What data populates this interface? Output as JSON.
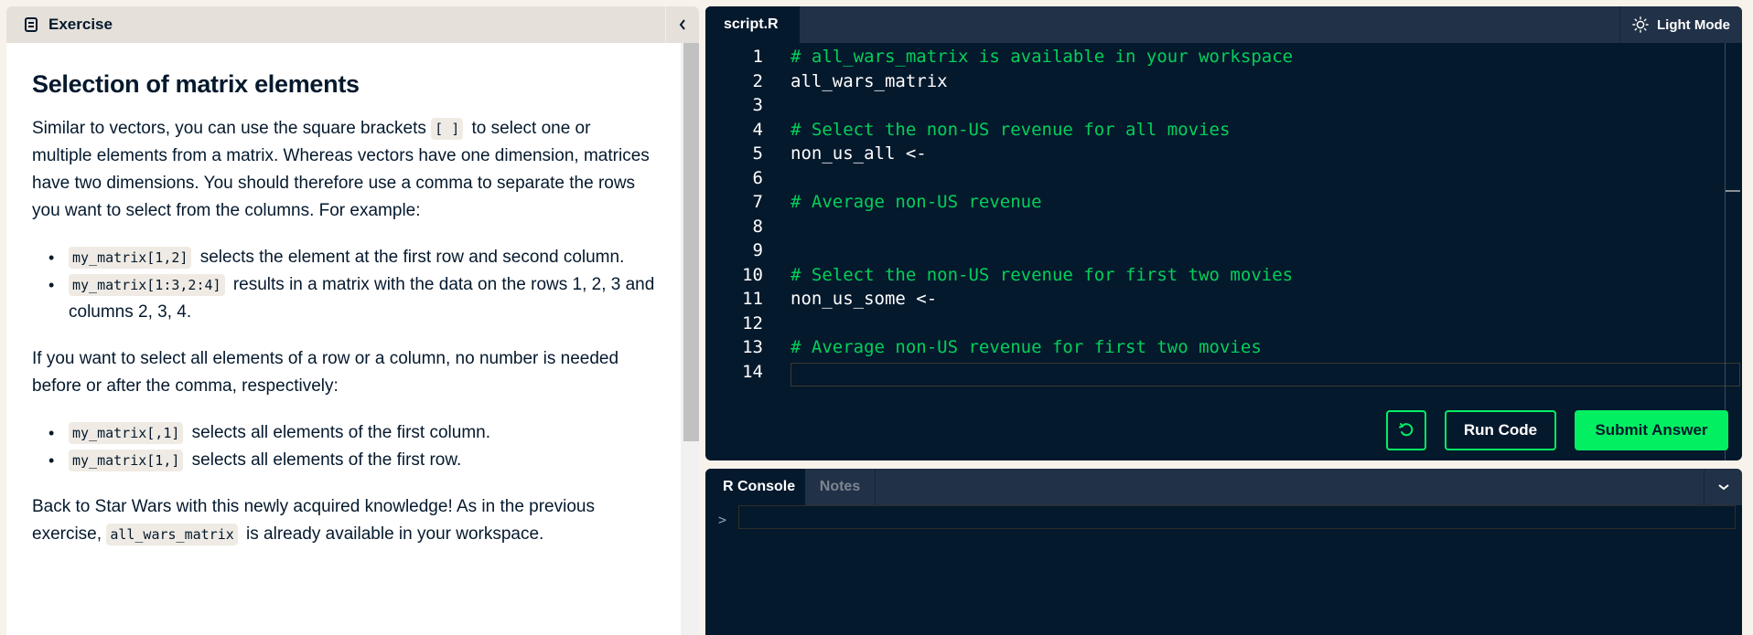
{
  "exercise_panel": {
    "header_title": "Exercise",
    "header_icon": "document-icon",
    "collapse_icon": "chevron-left-icon",
    "title": "Selection of matrix elements",
    "intro": {
      "before_code": "Similar to vectors, you can use the square brackets ",
      "code": "[ ]",
      "after_code": " to select one or multiple elements from a matrix. Whereas vectors have one dimension, matrices have two dimensions. You should therefore use a comma to separate the rows you want to select from the columns. For example:"
    },
    "examples_1": [
      {
        "code": "my_matrix[1,2]",
        "text": " selects the element at the first row and second column."
      },
      {
        "code": "my_matrix[1:3,2:4]",
        "text": " results in a matrix with the data on the rows 1, 2, 3 and columns 2, 3, 4."
      }
    ],
    "paragraph_2": "If you want to select all elements of a row or a column, no number is needed before or after the comma, respectively:",
    "examples_2": [
      {
        "code": "my_matrix[,1]",
        "text": " selects all elements of the first column."
      },
      {
        "code": "my_matrix[1,]",
        "text": " selects all elements of the first row."
      }
    ],
    "paragraph_3": {
      "before_code": "Back to Star Wars with this newly acquired knowledge! As in the previous exercise, ",
      "code": "all_wars_matrix",
      "after_code": " is already available in your workspace."
    }
  },
  "editor": {
    "tab_label": "script.R",
    "light_mode_label": "Light Mode",
    "light_mode_icon": "sun-icon",
    "lines": [
      {
        "n": "1",
        "text": "# all_wars_matrix is available in your workspace",
        "type": "comment"
      },
      {
        "n": "2",
        "text": "all_wars_matrix",
        "type": "plain"
      },
      {
        "n": "3",
        "text": "",
        "type": "plain"
      },
      {
        "n": "4",
        "text": "# Select the non-US revenue for all movies",
        "type": "comment"
      },
      {
        "n": "5",
        "text": "non_us_all <-",
        "type": "plain"
      },
      {
        "n": "6",
        "text": "",
        "type": "plain"
      },
      {
        "n": "7",
        "text": "# Average non-US revenue",
        "type": "comment"
      },
      {
        "n": "8",
        "text": "",
        "type": "plain"
      },
      {
        "n": "9",
        "text": "",
        "type": "plain"
      },
      {
        "n": "10",
        "text": "# Select the non-US revenue for first two movies",
        "type": "comment"
      },
      {
        "n": "11",
        "text": "non_us_some <-",
        "type": "plain"
      },
      {
        "n": "12",
        "text": "",
        "type": "plain"
      },
      {
        "n": "13",
        "text": "# Average non-US revenue for first two movies",
        "type": "comment"
      },
      {
        "n": "14",
        "text": "",
        "type": "plain"
      }
    ],
    "reset_icon": "reset-icon",
    "run_label": "Run Code",
    "submit_label": "Submit Answer"
  },
  "console": {
    "tabs": [
      "R Console",
      "Notes"
    ],
    "active_tab": "R Console",
    "prompt": ">",
    "input_value": "",
    "collapse_icon": "chevron-down-icon"
  },
  "colors": {
    "accent_green": "#03ef62",
    "navy": "#05192d",
    "tab_bar": "#213147",
    "beige_bg": "#f7f3eb"
  }
}
